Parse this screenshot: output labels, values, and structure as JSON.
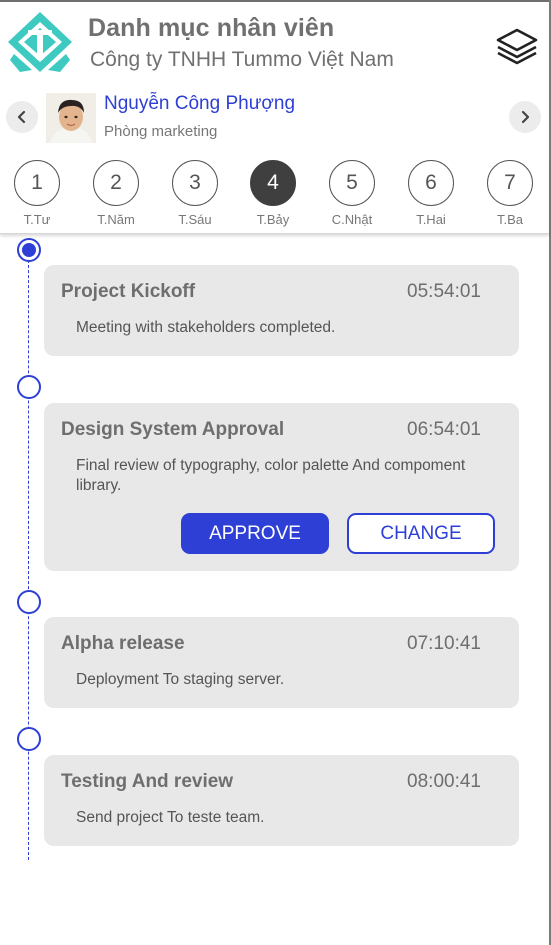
{
  "header": {
    "title": "Danh mục nhân viên",
    "subtitle": "Công ty TNHH Tummo Việt Nam",
    "logo_icon": "company-logo-icon",
    "menu_icon": "layers-icon"
  },
  "employee": {
    "name": "Nguyễn Công Phượng",
    "department": "Phòng marketing",
    "prev_icon": "chevron-left-icon",
    "next_icon": "chevron-right-icon"
  },
  "days": {
    "items": [
      {
        "number": "1",
        "label": "T.Tư"
      },
      {
        "number": "2",
        "label": "T.Năm"
      },
      {
        "number": "3",
        "label": "T.Sáu"
      },
      {
        "number": "4",
        "label": "T.Bảy"
      },
      {
        "number": "5",
        "label": "C.Nhật"
      },
      {
        "number": "6",
        "label": "T.Hai"
      },
      {
        "number": "7",
        "label": "T.Ba"
      }
    ],
    "selected": "4"
  },
  "timeline": {
    "items": [
      {
        "title": "Project Kickoff",
        "time": "05:54:01",
        "description": "Meeting with stakeholders completed."
      },
      {
        "title": "Design System Approval",
        "time": "06:54:01",
        "description": "Final review of typography, color palette And compoment library.",
        "approve_label": "APPROVE",
        "change_label": "CHANGE"
      },
      {
        "title": "Alpha release",
        "time": "07:10:41",
        "description": "Deployment To staging server."
      },
      {
        "title": "Testing And review",
        "time": "08:00:41",
        "description": "Send project To teste team."
      }
    ]
  },
  "colors": {
    "accent": "#2e3fd6",
    "card_bg": "#e8e8e8",
    "selected_day": "#3f3f3f"
  }
}
